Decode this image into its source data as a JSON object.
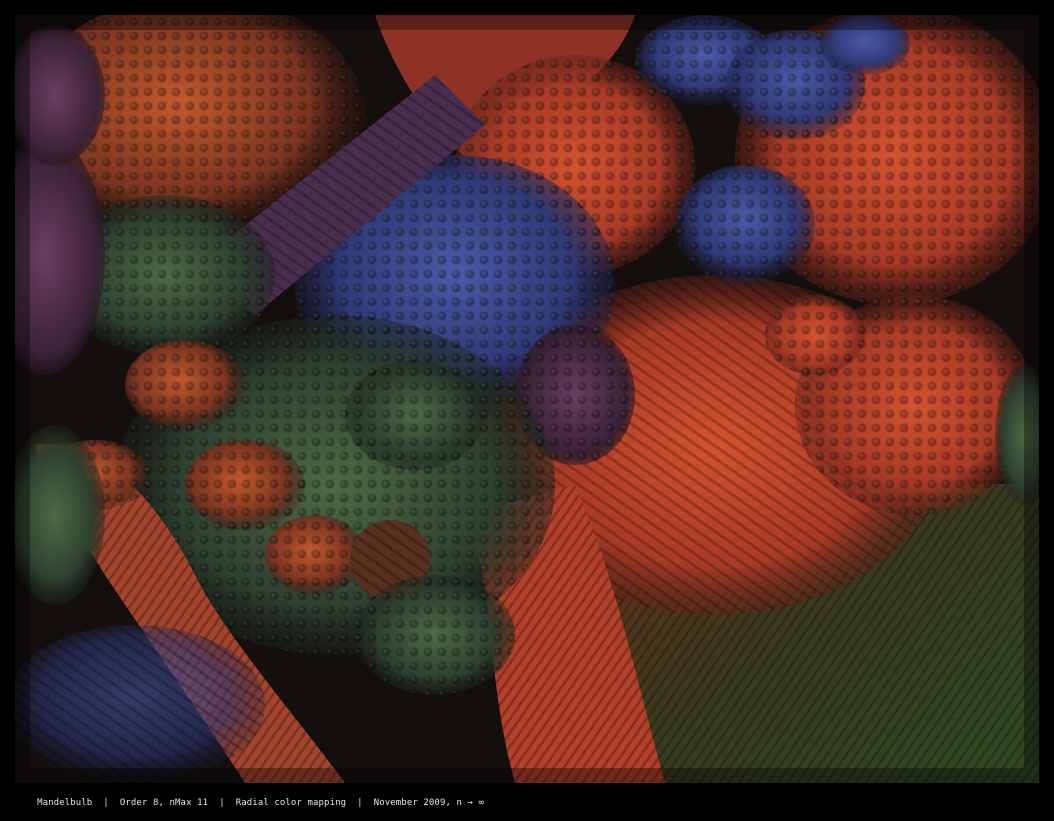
{
  "caption": {
    "title": "Mandelbulb",
    "separator": "  |  ",
    "order_info": "Order 8, nMax 11",
    "mapping": "Radial color mapping",
    "date_info": "November 2009, n → ∞"
  },
  "palette": {
    "background": "#120d0c",
    "red": "#c0442a",
    "orange": "#b4542e",
    "blue": "#3e4a8c",
    "green": "#3c5a3e",
    "purple": "#5a3a5c",
    "olive": "#5e5a2a"
  }
}
